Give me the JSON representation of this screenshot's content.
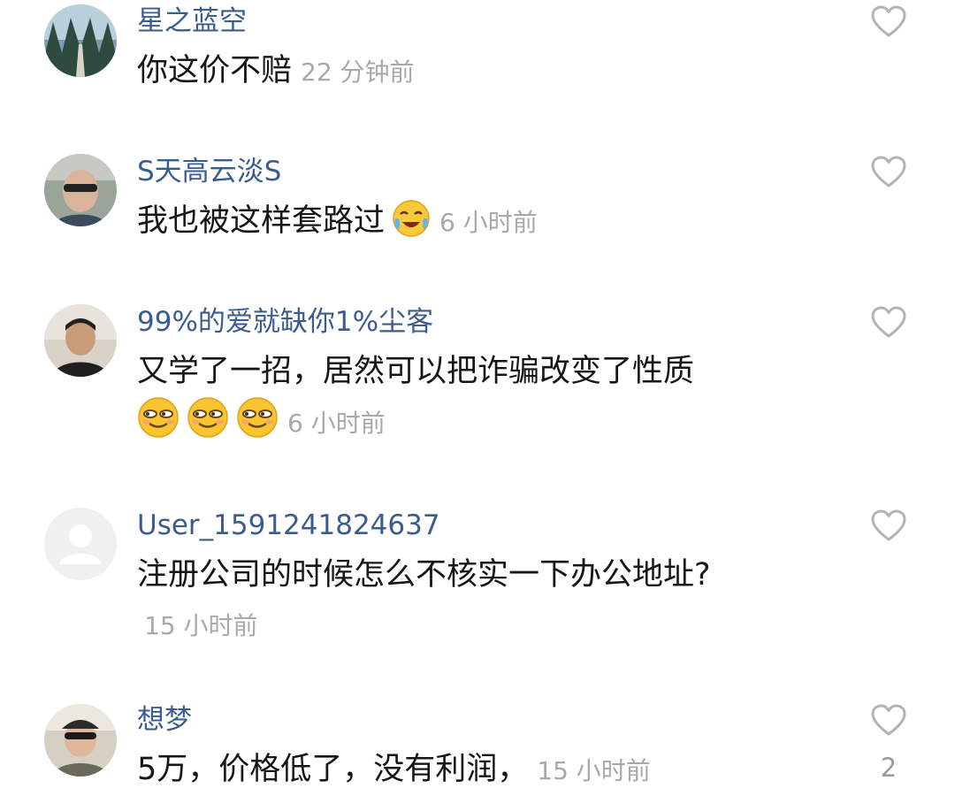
{
  "comments": [
    {
      "username": "星之蓝空",
      "text": "你这价不赔",
      "time": "22 分钟前",
      "avatar": "road-forest-photo"
    },
    {
      "username": "S天高云淡S",
      "text": "我也被这样套路过",
      "time": "6 小时前",
      "emojis": [
        "crying-laughing-emoji"
      ],
      "avatar": "man-sunglasses-photo"
    },
    {
      "username": "99%的爱就缺你1%尘客",
      "text": "又学了一招，居然可以把诈骗改变了性质",
      "time": "6 小时前",
      "emojis": [
        "smirk-emoji",
        "smirk-emoji",
        "smirk-emoji"
      ],
      "avatar": "boy-photo"
    },
    {
      "username": "User_1591241824637",
      "text": "注册公司的时候怎么不核实一下办公地址?",
      "time": "15 小时前",
      "avatar": "default-user-avatar"
    },
    {
      "username": "想梦",
      "text": "5万，价格低了，没有利润，",
      "time": "15 小时前",
      "like_count": "2",
      "avatar": "person-cap-photo"
    }
  ],
  "colors": {
    "username": "#3a5c8e",
    "text": "#161616",
    "time": "#a9a9a9",
    "like_icon": "#b3b3b3"
  },
  "icons": {
    "like": "heart-outline-icon"
  }
}
